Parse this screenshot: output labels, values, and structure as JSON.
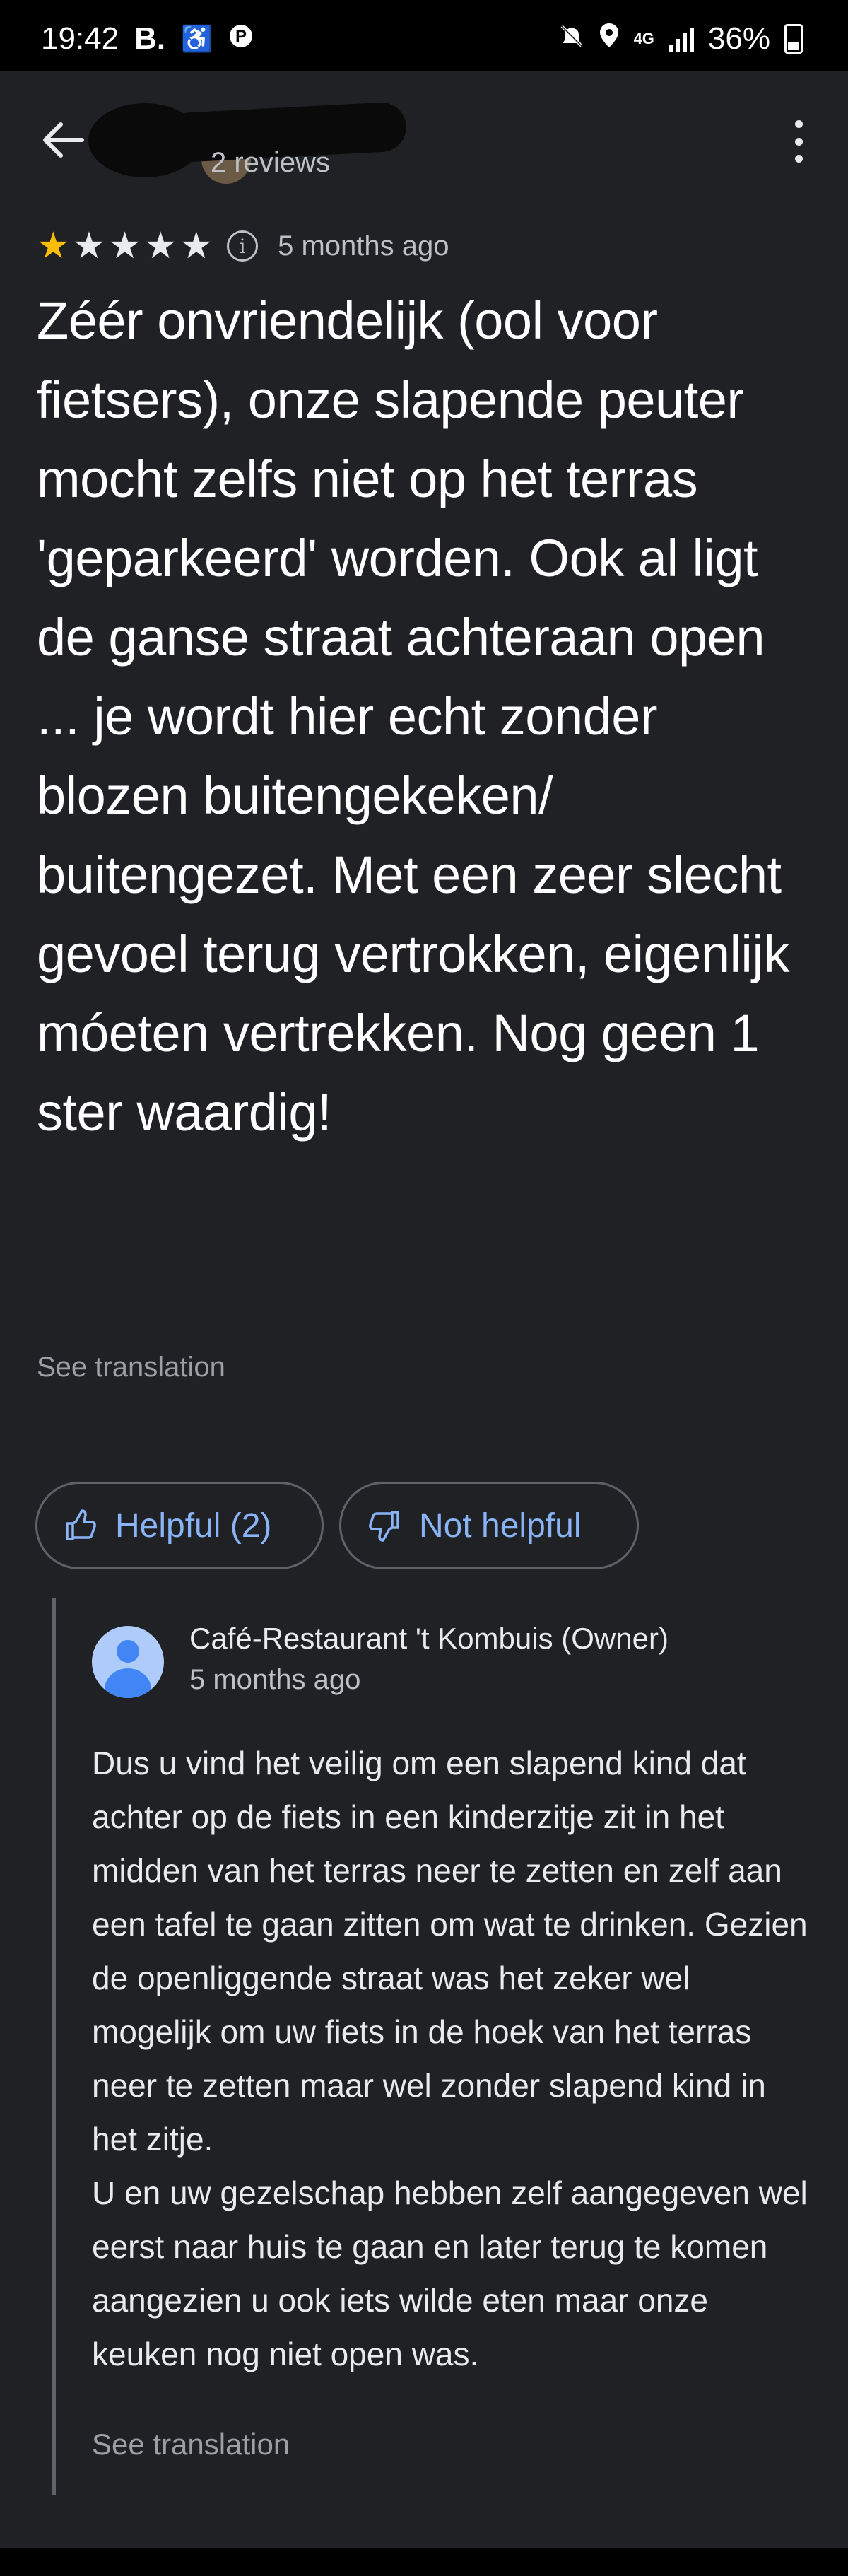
{
  "status_bar": {
    "time": "19:42",
    "left_icons": [
      "B.",
      "accessibility-icon",
      "pinterest-icon"
    ],
    "right_icons": [
      "mute-icon",
      "location-icon",
      "4g-icon",
      "signal-icon"
    ],
    "network": "4G",
    "battery": "36%"
  },
  "header": {
    "reviewer_count": "2 reviews"
  },
  "review": {
    "rating": 1,
    "max_rating": 5,
    "time_ago": "5 months ago",
    "text": "Zéér onvriendelijk (ool voor fietsers), onze slapende peuter mocht zelfs niet op het terras 'geparkeerd' worden. Ook al ligt de ganse straat achteraan open ... je wordt hier echt zonder blozen buitengekeken/ buitengezet. Met een zeer slecht gevoel terug vertrokken, eigenlijk móeten vertrekken. Nog geen 1 ster waardig!",
    "see_translation": "See translation",
    "helpful_label": "Helpful (2)",
    "not_helpful_label": "Not helpful"
  },
  "owner_reply": {
    "name": "Café-Restaurant 't Kombuis (Owner)",
    "time_ago": "5 months ago",
    "text_p1": "Dus u vind het veilig om een slapend kind dat achter op de fiets in een kinderzitje zit in het midden van het terras neer te zetten en zelf aan een tafel te gaan zitten om wat te drinken. Gezien de openliggende straat was het zeker wel mogelijk om uw fiets in de hoek van het terras neer te zetten maar wel zonder slapend kind in het zitje.",
    "text_p2": "U en uw gezelschap hebben zelf aangegeven wel eerst naar huis te gaan en later terug te komen aangezien u ook iets wilde eten maar onze keuken nog niet open was.",
    "see_translation": "See translation"
  },
  "colors": {
    "background": "#202124",
    "star": "#fbbc04",
    "accent": "#8ab4f8"
  }
}
